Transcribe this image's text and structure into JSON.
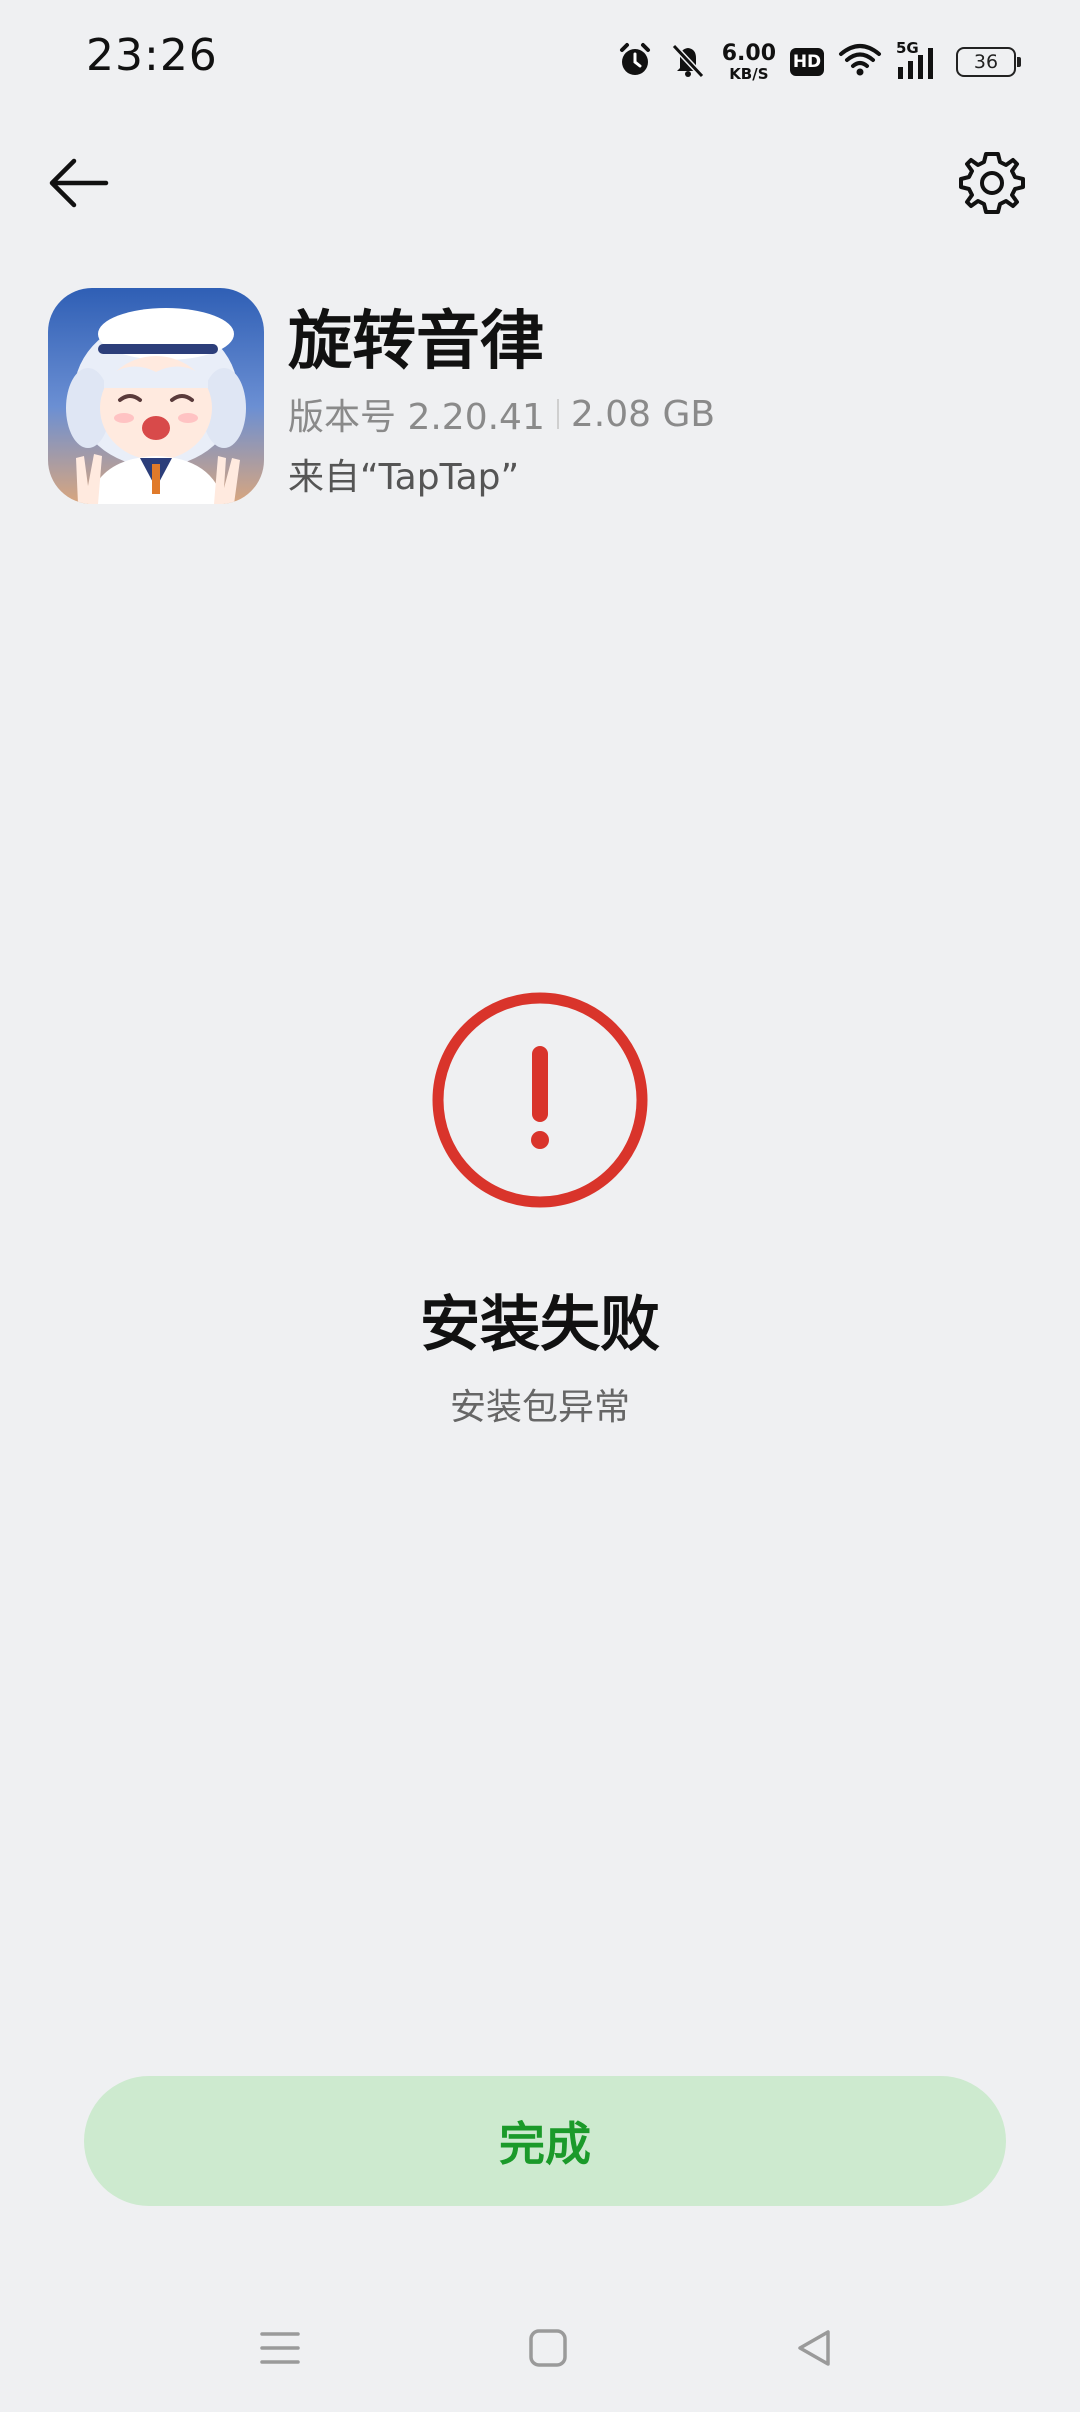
{
  "status_bar": {
    "time": "23:26",
    "net_speed_value": "6.00",
    "net_speed_unit": "KB/S",
    "hd_label": "HD",
    "signal_label": "5G",
    "battery_level": "36",
    "icons": [
      "alarm-icon",
      "mute-icon",
      "wifi-icon",
      "signal-icon",
      "battery-icon"
    ]
  },
  "header": {
    "back_icon": "back-arrow-icon",
    "settings_icon": "gear-icon"
  },
  "app": {
    "name": "旋转音律",
    "version": "版本号 2.20.41",
    "size": "2.08 GB",
    "source": "来自“TapTap”"
  },
  "result": {
    "icon": "error-exclamation-icon",
    "title": "安装失败",
    "subtitle": "安装包异常",
    "color": "#d9342b"
  },
  "actions": {
    "done_label": "完成",
    "done_color": "#1b9a2a",
    "done_bg": "#cdeacf"
  },
  "nav_bar": {
    "items": [
      "menu-icon",
      "home-icon",
      "back-triangle-icon"
    ]
  }
}
